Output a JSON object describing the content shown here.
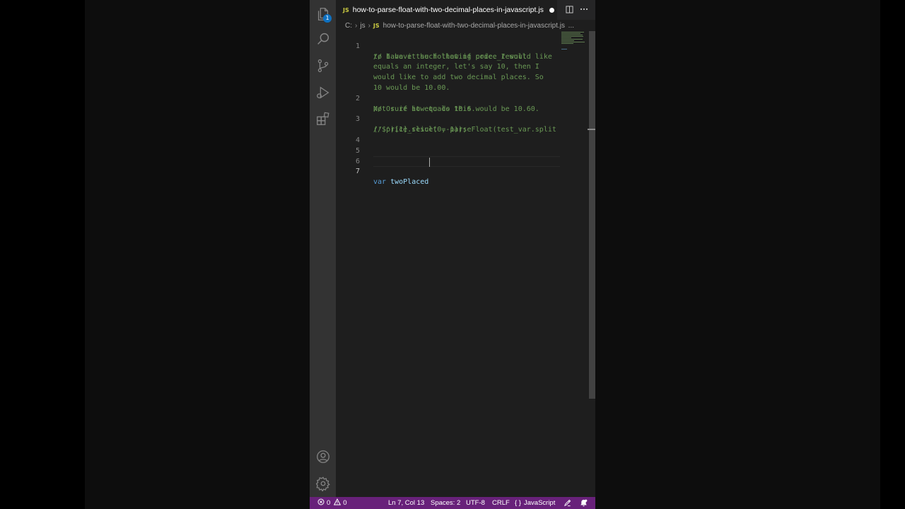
{
  "tab": {
    "language_badge": "JS",
    "filename": "how-to-parse-float-with-two-decimal-places-in-javascript.js"
  },
  "activity": {
    "explorer_badge": "1"
  },
  "breadcrumb": {
    "drive": "C:",
    "folder": "js",
    "language_badge": "JS",
    "file": "how-to-parse-float-with-two-decimal-places-in-javascript.js",
    "more": "..."
  },
  "editor": {
    "line_numbers": [
      "1",
      "2",
      "3",
      "4",
      "5",
      "6",
      "7"
    ],
    "rows": [
      "// I have the following code. I would like",
      "to have it such that if price_result",
      "equals an integer, let's say 10, then I",
      "would like to add two decimal places. So",
      "10 would be 10.00.",
      "// Or if it equals 10.6 would be 10.60.",
      "Not sure how to do this.",
      "// price_result = parseFloat(test_var.split",
      "('$')[1].slice(0,-1));"
    ],
    "keyword": "var",
    "identifier": "twoPlaced"
  },
  "status": {
    "errors": "0",
    "warnings": "0",
    "position": "Ln 7, Col 13",
    "spaces": "Spaces: 2",
    "encoding": "UTF-8",
    "eol": "CRLF",
    "language": "JavaScript",
    "language_icon": "{ }"
  },
  "colors": {
    "status_bar": "#68217a",
    "comment": "#6a9955",
    "keyword": "#569cd6",
    "identifier": "#9cdcfe",
    "activity_bar": "#333333",
    "editor_bg": "#1e1e1e"
  },
  "icons": [
    "files-icon",
    "search-icon",
    "source-control-icon",
    "run-debug-icon",
    "extensions-icon",
    "account-icon",
    "settings-gear-icon",
    "split-editor-icon",
    "more-actions-icon",
    "error-icon",
    "warning-icon",
    "feedback-icon",
    "bell-icon"
  ]
}
